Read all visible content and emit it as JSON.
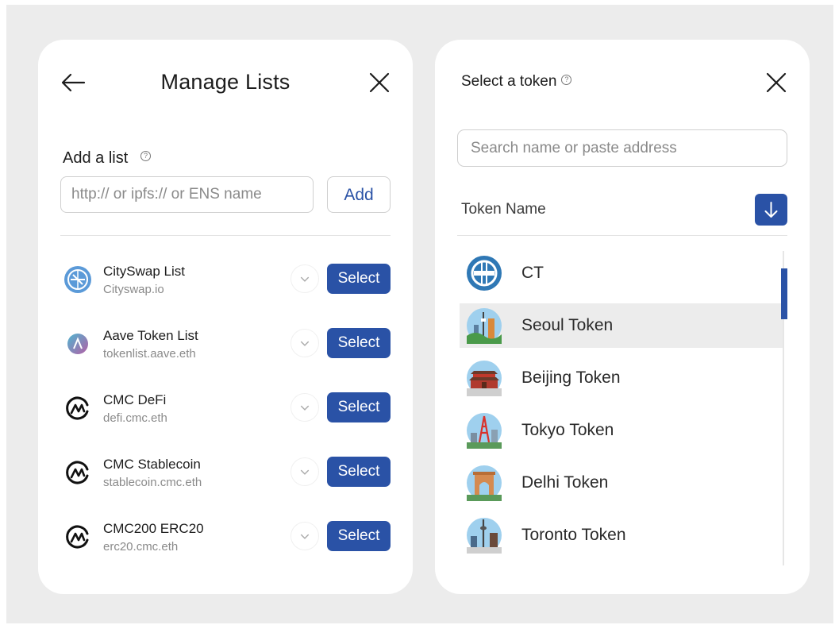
{
  "manage": {
    "title": "Manage Lists",
    "add_label": "Add a list",
    "help_glyph": "?",
    "url_placeholder": "http:// or ipfs:// or ENS name",
    "add_button": "Add",
    "lists": [
      {
        "name": "CitySwap List",
        "sub": "Cityswap.io",
        "select": "Select",
        "logo": "cityswap-logo-icon"
      },
      {
        "name": "Aave Token List",
        "sub": "tokenlist.aave.eth",
        "select": "Select",
        "logo": "aave-logo-icon"
      },
      {
        "name": "CMC DeFi",
        "sub": "defi.cmc.eth",
        "select": "Select",
        "logo": "cmc-logo-icon"
      },
      {
        "name": "CMC Stablecoin",
        "sub": "stablecoin.cmc.eth",
        "select": "Select",
        "logo": "cmc-logo-icon"
      },
      {
        "name": "CMC200 ERC20",
        "sub": "erc20.cmc.eth",
        "select": "Select",
        "logo": "cmc-logo-icon"
      }
    ]
  },
  "tokens": {
    "title": "Select a token",
    "help_glyph": "?",
    "search_placeholder": "Search name or paste address",
    "column_header": "Token Name",
    "items": [
      {
        "name": "CT",
        "icon": "ct-logo-icon"
      },
      {
        "name": "Seoul Token",
        "icon": "seoul-city-icon",
        "selected": true
      },
      {
        "name": "Beijing Token",
        "icon": "beijing-city-icon"
      },
      {
        "name": "Tokyo Token",
        "icon": "tokyo-city-icon"
      },
      {
        "name": "Delhi Token",
        "icon": "delhi-city-icon"
      },
      {
        "name": "Toronto Token",
        "icon": "toronto-city-icon"
      }
    ]
  },
  "colors": {
    "accent": "#2a52a6",
    "background": "#ececec",
    "card": "#ffffff",
    "selected_row": "#ececec"
  }
}
